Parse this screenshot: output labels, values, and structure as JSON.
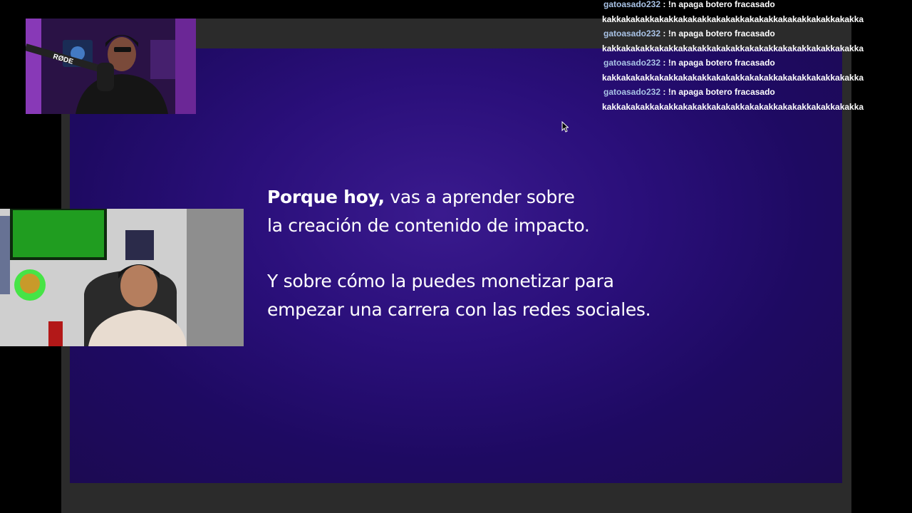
{
  "slide": {
    "line1_bold": "Porque hoy,",
    "line1_rest": " vas a aprender sobre",
    "line2": "la creación de contenido de impacto.",
    "para2": "Y sobre cómo la puedes monetizar para empezar una carrera con las redes sociales."
  },
  "chat": {
    "messages": [
      {
        "user": "gatoasado232",
        "sep": " : ",
        "text": "!n apaga botero fracasado",
        "cont": "kakkakakakkakakkakakakkakakakkakakakkakakakkakakkakakka"
      },
      {
        "user": "gatoasado232",
        "sep": " : ",
        "text": "!n apaga botero fracasado",
        "cont": "kakkakakakkakakkakakakkakakakkakakakkakakakkakakkakakka"
      },
      {
        "user": "gatoasado232",
        "sep": " : ",
        "text": "!n apaga botero fracasado",
        "cont": "kakkakakakkakakkakakakkakakakkakakakkakakakkakakkakakka"
      },
      {
        "user": "gatoasado232",
        "sep": " : ",
        "text": "!n apaga botero fracasado",
        "cont": "kakkakakakkakakkakakakkakakakkakakakkakakakkakakkakakka"
      }
    ]
  },
  "cams": {
    "top_mic_brand": "RØDE"
  }
}
